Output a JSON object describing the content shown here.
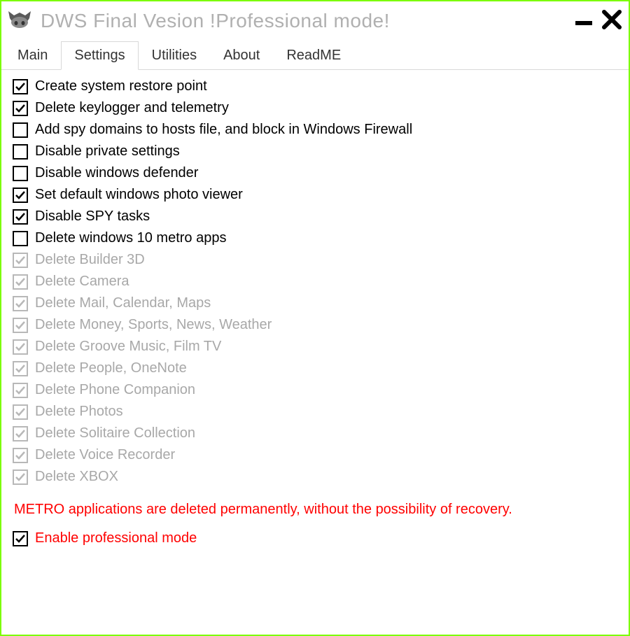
{
  "window": {
    "title": "DWS Final Vesion  !Professional mode!"
  },
  "tabs": {
    "main": "Main",
    "settings": "Settings",
    "utilities": "Utilities",
    "about": "About",
    "readme": "ReadME",
    "active": "settings"
  },
  "checkboxes": [
    {
      "label": "Create system restore point",
      "checked": true,
      "disabled": false
    },
    {
      "label": "Delete keylogger and telemetry",
      "checked": true,
      "disabled": false
    },
    {
      "label": "Add spy domains to hosts file, and block in Windows Firewall",
      "checked": false,
      "disabled": false
    },
    {
      "label": "Disable private settings",
      "checked": false,
      "disabled": false
    },
    {
      "label": "Disable windows defender",
      "checked": false,
      "disabled": false
    },
    {
      "label": "Set default windows photo viewer",
      "checked": true,
      "disabled": false
    },
    {
      "label": "Disable SPY tasks",
      "checked": true,
      "disabled": false
    },
    {
      "label": "Delete windows 10 metro apps",
      "checked": false,
      "disabled": false
    },
    {
      "label": "Delete Builder 3D",
      "checked": true,
      "disabled": true
    },
    {
      "label": "Delete Camera",
      "checked": true,
      "disabled": true
    },
    {
      "label": "Delete Mail, Calendar, Maps",
      "checked": true,
      "disabled": true
    },
    {
      "label": "Delete Money, Sports, News, Weather",
      "checked": true,
      "disabled": true
    },
    {
      "label": "Delete Groove Music, Film TV",
      "checked": true,
      "disabled": true
    },
    {
      "label": "Delete People, OneNote",
      "checked": true,
      "disabled": true
    },
    {
      "label": "Delete Phone Companion",
      "checked": true,
      "disabled": true
    },
    {
      "label": "Delete Photos",
      "checked": true,
      "disabled": true
    },
    {
      "label": "Delete Solitaire Collection",
      "checked": true,
      "disabled": true
    },
    {
      "label": "Delete Voice Recorder",
      "checked": true,
      "disabled": true
    },
    {
      "label": "Delete XBOX",
      "checked": true,
      "disabled": true
    }
  ],
  "warning": "METRO applications are deleted permanently, without the possibility of recovery.",
  "professional": {
    "label": "Enable professional mode",
    "checked": true
  }
}
